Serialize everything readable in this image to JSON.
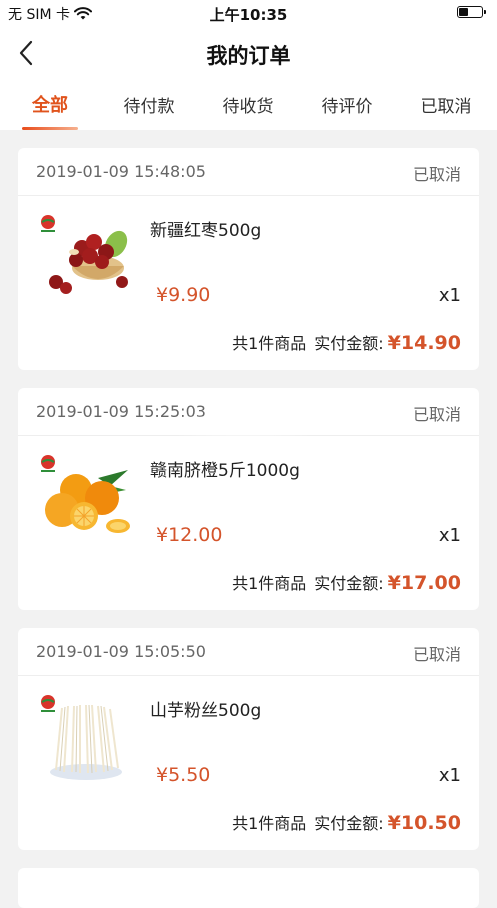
{
  "status_bar": {
    "carrier": "无 SIM 卡",
    "time": "上午10:35",
    "battery_level": 0.45
  },
  "nav": {
    "title": "我的订单",
    "back_icon": "chevron-left-icon"
  },
  "tabs": [
    {
      "label": "全部",
      "active": true
    },
    {
      "label": "待付款",
      "active": false
    },
    {
      "label": "待收货",
      "active": false
    },
    {
      "label": "待评价",
      "active": false
    },
    {
      "label": "已取消",
      "active": false
    }
  ],
  "colors": {
    "accent": "#e0531c",
    "price": "#d4542b",
    "background": "#f2f2f2"
  },
  "orders": [
    {
      "time": "2019-01-09 15:48:05",
      "status": "已取消",
      "product_name": "新疆红枣500g",
      "price": "¥9.90",
      "qty": "x1",
      "count_text": "共1件商品",
      "paid_label": "实付金额:",
      "total": "¥14.90",
      "image": "red-dates-image"
    },
    {
      "time": "2019-01-09 15:25:03",
      "status": "已取消",
      "product_name": "赣南脐橙5斤1000g",
      "price": "¥12.00",
      "qty": "x1",
      "count_text": "共1件商品",
      "paid_label": "实付金额:",
      "total": "¥17.00",
      "image": "navel-oranges-image"
    },
    {
      "time": "2019-01-09 15:05:50",
      "status": "已取消",
      "product_name": "山芋粉丝500g",
      "price": "¥5.50",
      "qty": "x1",
      "count_text": "共1件商品",
      "paid_label": "实付金额:",
      "total": "¥10.50",
      "image": "sweet-potato-vermicelli-image"
    }
  ]
}
